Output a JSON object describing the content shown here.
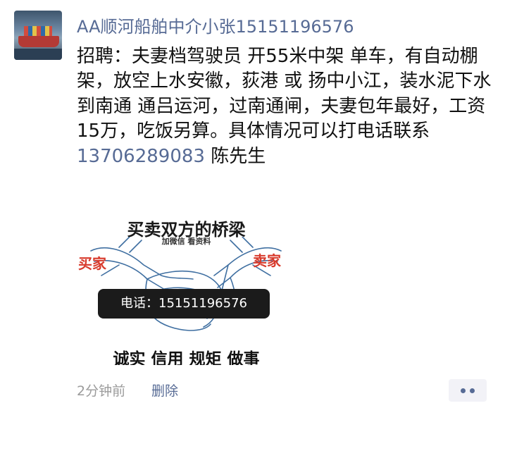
{
  "post": {
    "author": "AA顺河船舶中介小张15151196576",
    "text_before": "招聘：夫妻档驾驶员  开55米中架 单车，有自动棚架，放空上水安徽，荻港 或 扬中小江，装水泥下水 到南通 通吕运河，过南通闸，夫妻包年最好，工资15万，吃饭另算。具体情况可以打电话联系",
    "phone": "13706289083",
    "text_after": "  陈先生",
    "time": "2分钟前",
    "delete_label": "删除"
  },
  "ad_image": {
    "title": "买卖双方的桥梁",
    "subtitle": "加微信 看资料",
    "left_label": "买家",
    "right_label": "卖家",
    "phone_label": "电话：15151196576",
    "motto": "诚实 信用 规矩 做事"
  },
  "icons": {
    "avatar": "ship-avatar",
    "more": "more-dots-icon"
  },
  "colors": {
    "link": "#576b95",
    "text": "#111111",
    "meta": "#9b9b9b",
    "ad_red": "#d83a2c"
  }
}
